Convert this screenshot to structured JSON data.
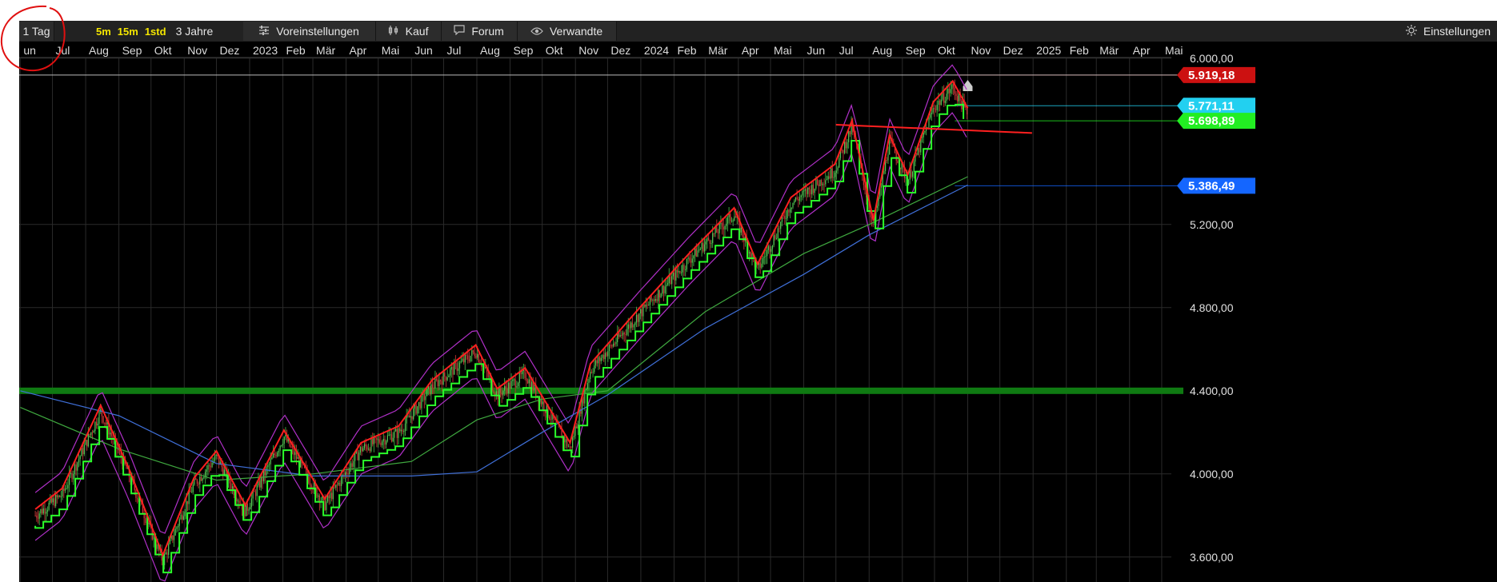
{
  "toolbar": {
    "period_label": "1 Tag",
    "interval_options": [
      "5m",
      "15m",
      "1std"
    ],
    "range_label": "3 Jahre",
    "presets_label": "Voreinstellungen",
    "buy_label": "Kauf",
    "forum_label": "Forum",
    "related_label": "Verwandte",
    "settings_label": "Einstellungen",
    "icons": {
      "presets": "sliders-icon",
      "buy": "candlestick-icon",
      "forum": "speech-bubble-icon",
      "related": "eye-icon",
      "settings": "sun-gear-icon"
    },
    "interval_color": "#f4e600"
  },
  "chart_data": {
    "type": "candlestick-line",
    "time_axis": {
      "labels": [
        "Jun",
        "Jul",
        "Aug",
        "Sep",
        "Okt",
        "Nov",
        "Dez",
        "2023",
        "Feb",
        "Mär",
        "Apr",
        "Mai",
        "Jun",
        "Jul",
        "Aug",
        "Sep",
        "Okt",
        "Nov",
        "Dez",
        "2024",
        "Feb",
        "Mär",
        "Apr",
        "Mai",
        "Jun",
        "Jul",
        "Aug",
        "Sep",
        "Okt",
        "Nov",
        "Dez",
        "2025",
        "Feb",
        "Mär",
        "Apr",
        "Mai"
      ],
      "first_label_display": "un",
      "range": [
        "2022-06",
        "2025-05"
      ]
    },
    "price_axis": {
      "ticks": [
        6000,
        5200,
        4800,
        4400,
        4000,
        3600
      ],
      "tick_labels": [
        "6.000,00",
        "5.200,00",
        "4.800,00",
        "4.400,00",
        "4.000,00",
        "3.600,00"
      ],
      "ylim": [
        3480,
        6080
      ]
    },
    "series": [
      {
        "role": "price",
        "color": "#3c9b3c",
        "points": [
          [
            "2022-06-15",
            3800
          ],
          [
            "2022-07-10",
            3900
          ],
          [
            "2022-08-15",
            4300
          ],
          [
            "2022-09-10",
            4000
          ],
          [
            "2022-10-12",
            3580
          ],
          [
            "2022-11-10",
            3950
          ],
          [
            "2022-12-01",
            4080
          ],
          [
            "2022-12-28",
            3820
          ],
          [
            "2023-02-02",
            4180
          ],
          [
            "2023-03-12",
            3850
          ],
          [
            "2023-04-15",
            4120
          ],
          [
            "2023-05-20",
            4200
          ],
          [
            "2023-06-20",
            4420
          ],
          [
            "2023-07-31",
            4590
          ],
          [
            "2023-08-20",
            4380
          ],
          [
            "2023-09-15",
            4480
          ],
          [
            "2023-10-27",
            4120
          ],
          [
            "2023-11-15",
            4500
          ],
          [
            "2023-12-31",
            4770
          ],
          [
            "2024-02-15",
            5030
          ],
          [
            "2024-03-28",
            5250
          ],
          [
            "2024-04-19",
            4980
          ],
          [
            "2024-05-20",
            5300
          ],
          [
            "2024-06-30",
            5460
          ],
          [
            "2024-07-16",
            5670
          ],
          [
            "2024-08-05",
            5190
          ],
          [
            "2024-08-20",
            5600
          ],
          [
            "2024-09-06",
            5410
          ],
          [
            "2024-09-30",
            5760
          ],
          [
            "2024-10-18",
            5860
          ],
          [
            "2024-11-01",
            5730
          ]
        ]
      },
      {
        "role": "ma-200",
        "color": "#3f6fd8",
        "points": [
          [
            "2022-06-01",
            4400
          ],
          [
            "2022-09-01",
            4280
          ],
          [
            "2022-12-01",
            4050
          ],
          [
            "2023-03-01",
            3990
          ],
          [
            "2023-06-01",
            3990
          ],
          [
            "2023-08-01",
            4010
          ],
          [
            "2023-10-01",
            4200
          ],
          [
            "2023-12-01",
            4380
          ],
          [
            "2024-03-01",
            4700
          ],
          [
            "2024-06-01",
            4960
          ],
          [
            "2024-08-01",
            5150
          ],
          [
            "2024-11-01",
            5390
          ]
        ]
      },
      {
        "role": "ma-100",
        "color": "#3fa83f",
        "points": [
          [
            "2022-06-01",
            4320
          ],
          [
            "2022-09-01",
            4120
          ],
          [
            "2022-12-01",
            3970
          ],
          [
            "2023-03-01",
            4000
          ],
          [
            "2023-06-01",
            4060
          ],
          [
            "2023-08-01",
            4260
          ],
          [
            "2023-10-01",
            4360
          ],
          [
            "2023-12-01",
            4400
          ],
          [
            "2024-03-01",
            4780
          ],
          [
            "2024-06-01",
            5060
          ],
          [
            "2024-08-01",
            5200
          ],
          [
            "2024-11-01",
            5430
          ]
        ]
      }
    ],
    "horizontal_levels": [
      {
        "value": 4400,
        "color": "#0f7a12",
        "kind": "support-band"
      },
      {
        "value": 5919.18,
        "label": "5.919,18",
        "color": "#cc1111",
        "marker": true
      },
      {
        "value": 5771.11,
        "label": "5.771,11",
        "color": "#22d0f0",
        "marker": true
      },
      {
        "value": 5698.89,
        "label": "5.698,89",
        "color": "#22ee22",
        "marker": true
      },
      {
        "value": 5386.49,
        "label": "5.386,49",
        "color": "#1466ff",
        "marker": true
      }
    ],
    "colors": {
      "background": "#000000",
      "grid": "#2a2a2a",
      "trend": "#ff2020",
      "band": "#b030c8",
      "signal": "#2aff2a"
    }
  }
}
